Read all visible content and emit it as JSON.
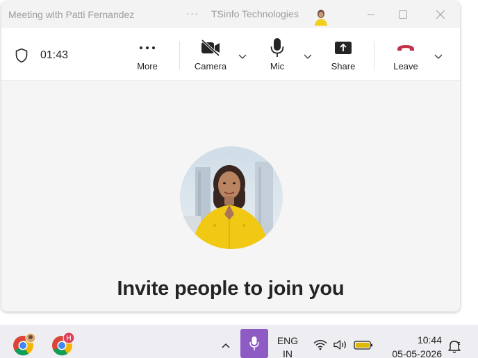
{
  "window": {
    "title": "Meeting with Patti Fernandez",
    "more_dots": "···",
    "org_name": "TSinfo Technologies"
  },
  "toolbar": {
    "timer": "01:43",
    "buttons": {
      "more": "More",
      "camera": "Camera",
      "mic": "Mic",
      "share": "Share",
      "leave": "Leave"
    }
  },
  "stage": {
    "invite_text": "Invite people to join you"
  },
  "taskbar": {
    "badge_letter": "H",
    "lang_line1": "ENG",
    "lang_line2": "IN",
    "time": "10:44",
    "date": "05-05-2026"
  },
  "colors": {
    "leave_red": "#c4314b",
    "mic_tile": "#8e5bc5",
    "battery": "#e0b800"
  }
}
